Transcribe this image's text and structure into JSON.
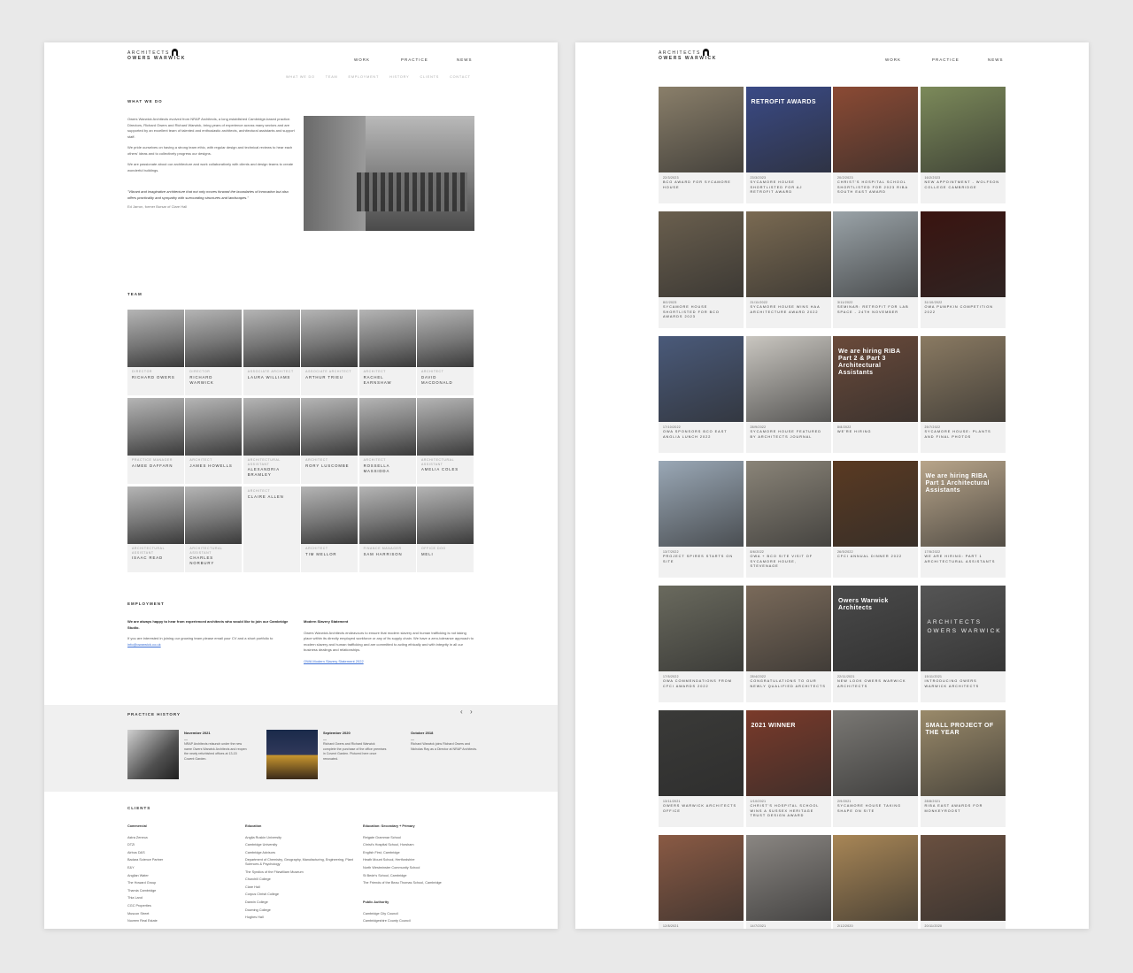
{
  "logo": {
    "line1": "ARCHITECTS",
    "line2": "OWERS WARWICK"
  },
  "nav": [
    "WORK",
    "PRACTICE",
    "NEWS"
  ],
  "subnav": [
    "WHAT WE DO",
    "TEAM",
    "EMPLOYMENT",
    "HISTORY",
    "CLIENTS",
    "CONTACT"
  ],
  "what": {
    "heading": "WHAT WE DO",
    "p1": "Owers Warwick Architects evolved from NRAP Architects, a long established Cambridge-based practice. Directors, Richard Owers and Richard Warwick, bring years of experience across many sectors and are supported by an excellent team of talented and enthusiastic architects, architectural assistants and support staff.",
    "p2": "We pride ourselves on having a strong team ethic, with regular design and technical reviews to hear each others' ideas and to collectively progress our designs.",
    "p3": "We are passionate about our architecture and work collaboratively with clients and design teams to create wonderful buildings.",
    "quote": "\"Vibrant and imaginative architecture that not only moves forward the boundaries of innovation but also offers practicality and sympathy with surrounding structures and landscapes.\"",
    "quote_author": "Ed Jarron, former Bursar of Clare Hall"
  },
  "team": {
    "heading": "TEAM",
    "members": [
      {
        "role": "DIRECTOR",
        "name": "RICHARD OWERS"
      },
      {
        "role": "DIRECTOR",
        "name": "RICHARD WARWICK"
      },
      {
        "role": "ASSOCIATE ARCHITECT",
        "name": "LAURA WILLIAMS"
      },
      {
        "role": "ASSOCIATE ARCHITECT",
        "name": "ARTHUR TRIEU"
      },
      {
        "role": "ARCHITECT",
        "name": "RACHEL EARNSHAW"
      },
      {
        "role": "ARCHITECT",
        "name": "DAVID MACDONALD"
      },
      {
        "role": "PRACTICE MANAGER",
        "name": "AIMEE DAFFARN"
      },
      {
        "role": "ARCHITECT",
        "name": "JAMES HOWELLS"
      },
      {
        "role": "ARCHITECTURAL ASSISTANT",
        "name": "ALEXANDRIA BRAMLEY"
      },
      {
        "role": "ARCHITECT",
        "name": "RORY LUSCOMBE"
      },
      {
        "role": "ARCHITECT",
        "name": "ROSSELLA MASSIDDA"
      },
      {
        "role": "ARCHITECTURAL ASSISTANT",
        "name": "AMELIA COLES"
      },
      {
        "role": "ARCHITECTURAL ASSISTANT",
        "name": "ISAAC READ"
      },
      {
        "role": "ARCHITECTURAL ASSISTANT",
        "name": "CHARLES NORBURY"
      },
      {
        "role": "ARCHITECT",
        "name": "CLAIRE ALLEN"
      },
      {
        "role": "ARCHITECT",
        "name": "TIM MELLOR"
      },
      {
        "role": "FINANCE MANAGER",
        "name": "SAM HARRISON"
      },
      {
        "role": "OFFICE DOG",
        "name": "MELI"
      }
    ]
  },
  "employment": {
    "heading": "EMPLOYMENT",
    "lead": "We are always happy to hear from experienced architects who would like to join our Cambridge Studio.",
    "body": "If you are interested in joining our growing team please email your CV and a short portfolio to",
    "email": "info@owarwick.co.uk",
    "slavery_heading": "Modern Slavery Statement",
    "slavery_body": "Owers Warwick Architects endeavours to ensure that modern slavery and human trafficking is not taking place within its directly employed workforce or any of its supply chain. We have a zero-tolerance approach to modern slavery and human trafficking and are committed to acting ethically and with integrity in all our business dealings and relationships.",
    "slavery_link": "OWA Modern Slavery Statement 2022"
  },
  "history": {
    "heading": "PRACTICE HISTORY",
    "items": [
      {
        "date": "November 2021",
        "text": "NRAP Architects relaunch under the new name Owers Warwick Architects and reopen the newly refurbished offices at 13-15 Covent Garden."
      },
      {
        "date": "September 2020",
        "text": "Richard Owers and Richard Warwick complete the purchase of the office premises in Covent Garden. Pictured here once renovated."
      },
      {
        "date": "October 2018",
        "text": "Richard Warwick joins Richard Owers and Nicholas Ray as a Director at NRAP Architects."
      }
    ]
  },
  "clients": {
    "heading": "CLIENTS",
    "cols": [
      {
        "title": "Commercial",
        "items": [
          "Astra Zeneca",
          "DTZi",
          "Airbus D&S",
          "Badara Science Partner",
          "E&Y",
          "Anglian Water",
          "The Howard Group",
          "Thamia Cambridge",
          "Thia Land",
          "CGC Properties",
          "Muscon Street",
          "Nuveen Real Estate"
        ]
      },
      {
        "title": "Education",
        "items": [
          "Anglia Ruskin University",
          "Cambridge University",
          "Cambridge Advisors",
          "Department of Chemistry, Geography, Manufacturing, Engineering, Plant Sciences & Psychology",
          "The Syndics of the Fitzwilliam Museum",
          "Churchill College",
          "Clare Hall",
          "Corpus Christi College",
          "Darwin College",
          "Downing College",
          "Hughes Hall"
        ]
      },
      {
        "title": "Education: Secondary + Primary",
        "items": [
          "Reigate Grammar School",
          "Christ's Hospital School, Horsham",
          "English First, Cambridge",
          "Heath Mount School, Hertfordshire",
          "North Westminster Community School",
          "St Bede's School, Cambridge",
          "The Friends of the Beau Thomas School, Cambridge"
        ]
      },
      {
        "title": "Public Authority",
        "items": [
          "Cambridge City Council",
          "Cambridgeshire County Council"
        ]
      }
    ]
  },
  "news": [
    {
      "date": "22/3/2023",
      "title": "BCO AWARD FOR SYCAMORE HOUSE",
      "c": "#8a7f6a"
    },
    {
      "date": "23/3/2023",
      "title": "SYCAMORE HOUSE SHORTLISTED FOR AJ RETROFIT AWARD",
      "c": "#3a4a86",
      "overlay": "RETROFIT AWARDS"
    },
    {
      "date": "20/2/2023",
      "title": "CHRIST'S HOSPITAL SCHOOL SHORTLISTED FOR 2023 RIBA SOUTH EAST AWARD",
      "c": "#8b4a34"
    },
    {
      "date": "16/2/2023",
      "title": "NEW APPOINTMENT - WOLFSON COLLEGE CAMBRIDGE",
      "c": "#7c8a5a"
    },
    {
      "date": "8/2/2023",
      "title": "SYCAMORE HOUSE SHORTLISTED FOR BCO AWARDS 2023",
      "c": "#6a5f4e"
    },
    {
      "date": "21/11/2022",
      "title": "SYCAMORE HOUSE WINS HAA ARCHITECTURE AWARD 2022",
      "c": "#7a6a52"
    },
    {
      "date": "3/11/2022",
      "title": "SEMINAR: RETROFIT FOR LAB SPACE - 24TH NOVEMBER",
      "c": "#9aa3a8"
    },
    {
      "date": "31/10/2022",
      "title": "OWA PUMPKIN COMPETITION 2022",
      "c": "#3a1410"
    },
    {
      "date": "17/10/2022",
      "title": "OWA SPONSORS BCO EAST ANGLIA LUNCH 2022",
      "c": "#4a5a7a"
    },
    {
      "date": "28/9/2022",
      "title": "SYCAMORE HOUSE FEATURED BY ARCHITECTS JOURNAL",
      "c": "#c9c6c0"
    },
    {
      "date": "8/8/2022",
      "title": "WE'RE HIRING",
      "c": "#6a4a3a",
      "overlay": "We are hiring RIBA Part 2 & Part 3 Architectural Assistants"
    },
    {
      "date": "25/7/2022",
      "title": "SYCAMORE HOUSE: PLANTS AND FINAL PHOTOS",
      "c": "#8a7a62"
    },
    {
      "date": "13/7/2022",
      "title": "PROJECT SPIRES STARTS ON SITE",
      "c": "#9aa8b6"
    },
    {
      "date": "8/6/2022",
      "title": "OWA + BCO SITE VISIT OF SYCAMORE HOUSE, STEVENAGE",
      "c": "#8a8478"
    },
    {
      "date": "26/5/2022",
      "title": "CFCI ANNUAL DINNER 2022",
      "c": "#5a3a22"
    },
    {
      "date": "17/5/2022",
      "title": "WE ARE HIRING: PART 1 ARCHITECTURAL ASSISTANTS",
      "c": "#b8a58a",
      "overlay": "We are hiring RIBA Part 1 Architectural Assistants"
    },
    {
      "date": "17/5/2022",
      "title": "OWA COMMENDATIONS FROM CFCI AWARDS 2022",
      "c": "#6a6a5e"
    },
    {
      "date": "28/4/2022",
      "title": "CONGRATULATIONS TO OUR NEWLY QUALIFIED ARCHITECTS",
      "c": "#7a6a5a"
    },
    {
      "date": "22/11/2021",
      "title": "NEW LOOK OWERS WARWICK ARCHITECTS",
      "c": "#4a4a4a",
      "overlay": "Owers Warwick Architects"
    },
    {
      "date": "15/11/2021",
      "title": "INTRODUCING OWERS WARWICK ARCHITECTS",
      "c": "#555555",
      "logo": true
    },
    {
      "date": "13/11/2021",
      "title": "OWERS WARWICK ARCHITECTS OFFICE",
      "c": "#3a3a38"
    },
    {
      "date": "1/10/2021",
      "title": "CHRIST'S HOSPITAL SCHOOL WINS A SUSSEX HERITAGE TRUST DESIGN AWARD",
      "c": "#7a3a2a",
      "overlay": "2021 WINNER"
    },
    {
      "date": "2/9/2021",
      "title": "SYCAMORE HOUSE TAKING SHAPE ON SITE",
      "c": "#7a7874"
    },
    {
      "date": "28/8/2021",
      "title": "RIBA EAST AWARDS FOR MONKEYROOST",
      "c": "#9a8a6a",
      "overlay": "SMALL PROJECT OF THE YEAR"
    },
    {
      "date": "12/8/2021",
      "title": "",
      "c": "#8a5a44"
    },
    {
      "date": "14/7/2021",
      "title": "",
      "c": "#8a8682"
    },
    {
      "date": "2/12/2020",
      "title": "",
      "c": "#a88656"
    },
    {
      "date": "20/11/2020",
      "title": "",
      "c": "#6a5040"
    }
  ]
}
